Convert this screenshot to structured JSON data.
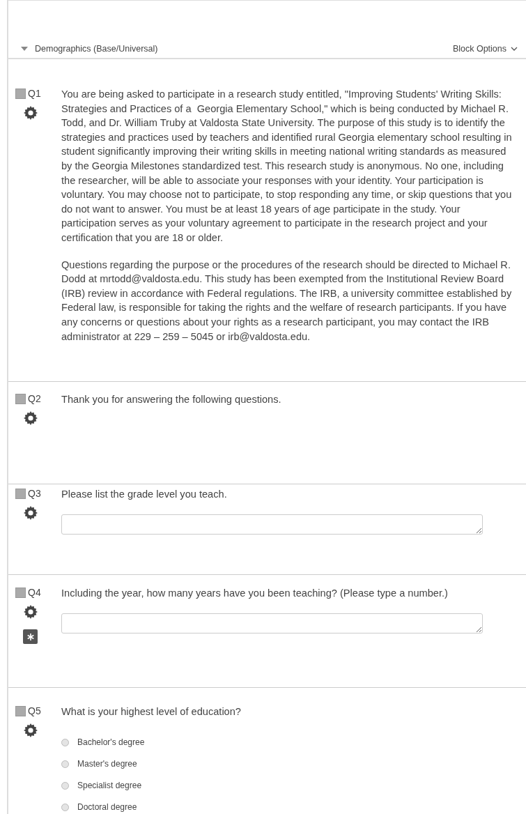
{
  "block": {
    "title": "Demographics (Base/Universal)",
    "expanded": true,
    "options_label": "Block Options"
  },
  "questions": [
    {
      "number": "Q1",
      "kind": "descriptive",
      "checked": false,
      "paragraphs": [
        "You are being asked to participate in a research study entitled, \"Improving Students' Writing Skills: Strategies and Practices of a  Georgia Elementary School,\" which is being conducted by Michael R. Todd, and Dr. William Truby at Valdosta State University. The purpose of this study is to identify the strategies and practices used by teachers and identified rural Georgia elementary school resulting in student significantly improving their writing skills in meeting national writing standards as measured by the Georgia Milestones standardized test. This research study is anonymous. No one, including the researcher, will be able to associate your responses with your identity. Your participation is voluntary. You may choose not to participate, to stop responding any time, or skip questions that you do not want to answer. You must be at least 18 years of age participate in the study. Your participation serves as your voluntary agreement to participate in the research project and your certification that you are 18 or older.",
        "Questions regarding the purpose or the procedures of the research should be directed to Michael R. Dodd at mrtodd@valdosta.edu. This study has been exempted from the Institutional Review Board (IRB) review in accordance with Federal regulations. The IRB, a university committee established by Federal law, is responsible for taking the rights and the welfare of research participants. If you have any concerns or questions about your rights as a research participant, you may contact the IRB administrator at 229 – 259 – 5045 or irb@valdosta.edu."
      ],
      "force_response": false
    },
    {
      "number": "Q2",
      "kind": "descriptive",
      "checked": false,
      "paragraphs": [
        "Thank you for answering the following questions."
      ],
      "force_response": false
    },
    {
      "number": "Q3",
      "kind": "text_entry",
      "checked": false,
      "paragraphs": [
        "Please list the grade level you teach."
      ],
      "force_response": false
    },
    {
      "number": "Q4",
      "kind": "text_entry",
      "checked": false,
      "paragraphs": [
        "Including the year, how many years have you been teaching? (Please type a number.)"
      ],
      "force_response": true
    },
    {
      "number": "Q5",
      "kind": "multiple_choice",
      "checked": false,
      "paragraphs": [
        "What is your highest level of education?"
      ],
      "force_response": false,
      "choices": [
        {
          "label": "Bachelor's degree",
          "selected": false
        },
        {
          "label": "Master's degree",
          "selected": false
        },
        {
          "label": "Specialist degree",
          "selected": false
        },
        {
          "label": "Doctoral degree",
          "selected": false
        }
      ]
    }
  ]
}
